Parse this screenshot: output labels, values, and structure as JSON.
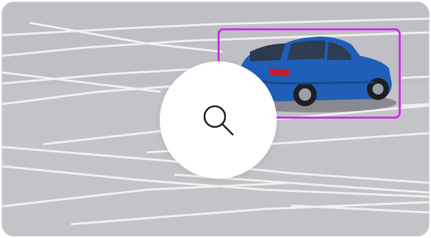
{
  "image": {
    "subject": "blue-hatchback-car",
    "scene": "parking-lot"
  },
  "detection": {
    "box_color": "#cc2fe6"
  },
  "search_button": {
    "icon": "search-icon"
  },
  "colors": {
    "car_body": "#1f5fb8",
    "asphalt": "#c2c2c7",
    "lines": "#f2f2f2"
  }
}
